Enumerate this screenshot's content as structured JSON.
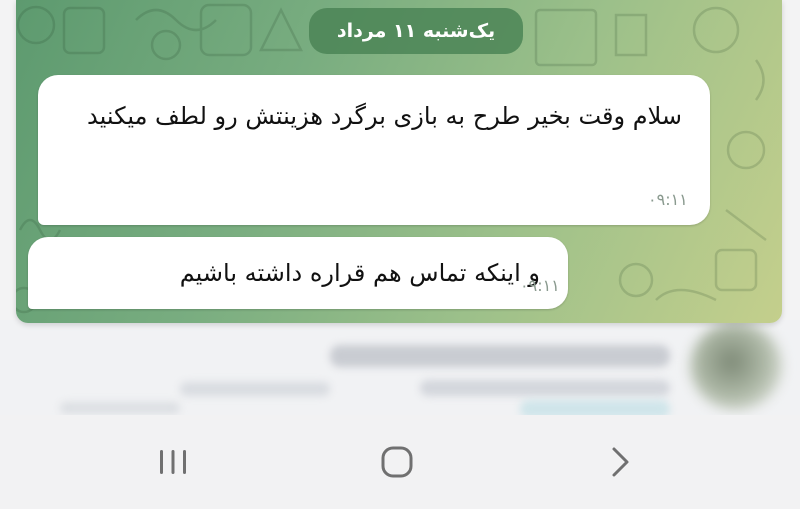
{
  "chat": {
    "date_label": "یک‌شنبه ۱۱ مرداد",
    "messages": [
      {
        "text": "سلام وقت بخیر طرح به بازی برگرد هزینتش رو لطف میکنید",
        "time": "۰۹:۱۱"
      },
      {
        "text": "و اینکه تماس هم قراره داشته باشیم",
        "time": "۰۹:۱۱"
      }
    ],
    "colors": {
      "wallpaper_start": "#5d9a6f",
      "wallpaper_end": "#c4cf8c",
      "bubble": "#ffffff",
      "date_pill": "#498254"
    }
  },
  "nav_bar": {
    "buttons": [
      {
        "icon": "recent-apps-icon"
      },
      {
        "icon": "home-icon"
      },
      {
        "icon": "back-icon"
      }
    ]
  }
}
